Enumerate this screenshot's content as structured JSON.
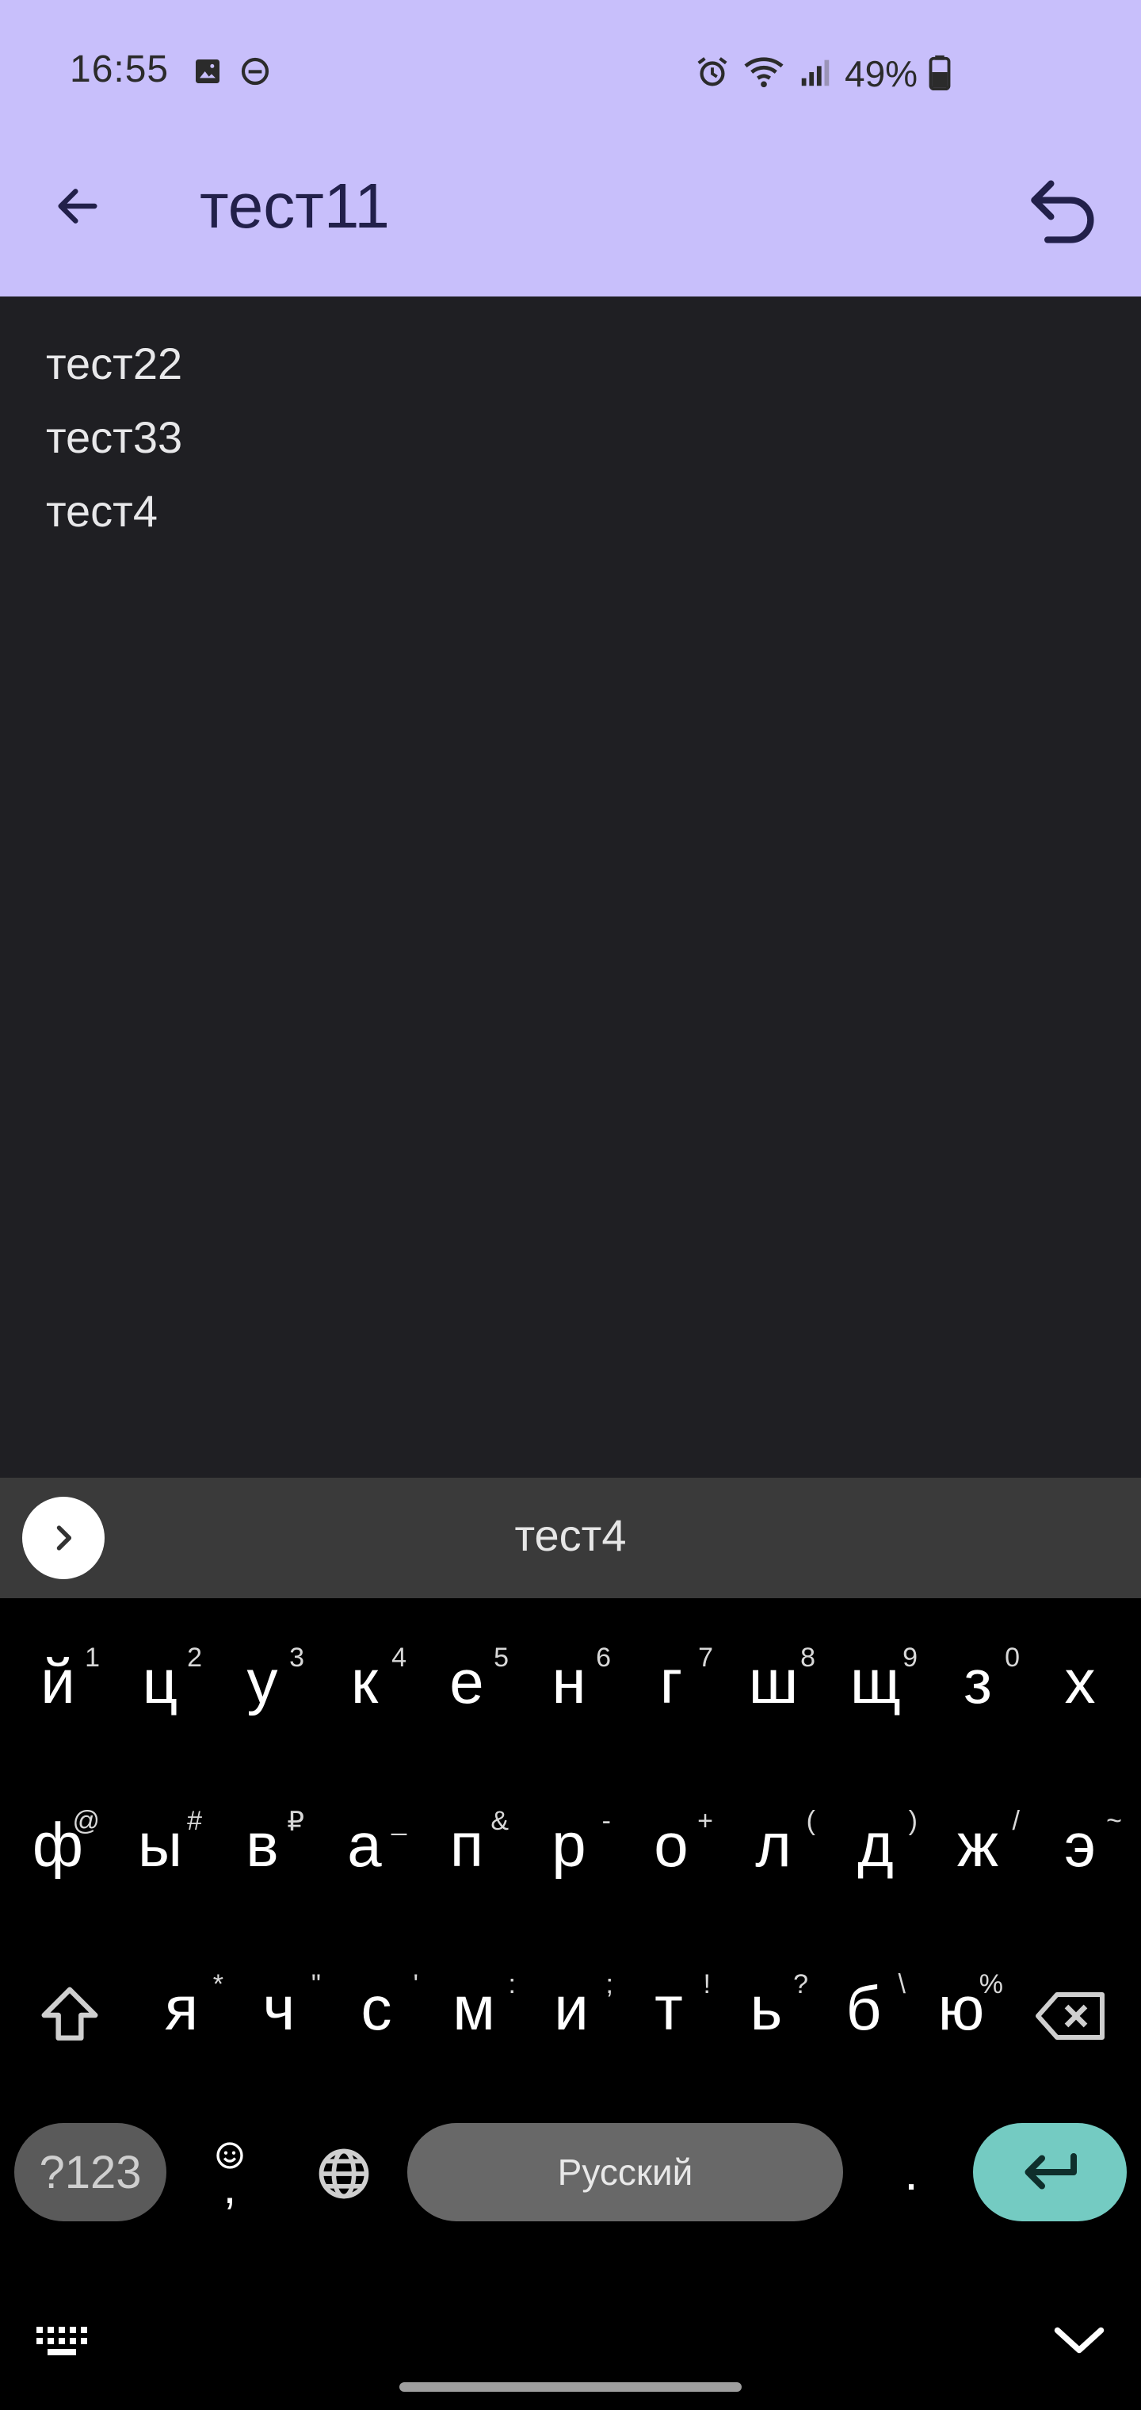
{
  "status": {
    "time": "16:55",
    "battery": "49%"
  },
  "appbar": {
    "title": "тест11"
  },
  "content": {
    "lines": [
      "тест22",
      "тест33",
      "тест4"
    ]
  },
  "suggestion": {
    "word": "тест4"
  },
  "keyboard": {
    "row1": [
      {
        "k": "й",
        "h": "1"
      },
      {
        "k": "ц",
        "h": "2"
      },
      {
        "k": "у",
        "h": "3"
      },
      {
        "k": "к",
        "h": "4"
      },
      {
        "k": "е",
        "h": "5"
      },
      {
        "k": "н",
        "h": "6"
      },
      {
        "k": "г",
        "h": "7"
      },
      {
        "k": "ш",
        "h": "8"
      },
      {
        "k": "щ",
        "h": "9"
      },
      {
        "k": "з",
        "h": "0"
      },
      {
        "k": "х",
        "h": ""
      }
    ],
    "row2": [
      {
        "k": "ф",
        "h": "@"
      },
      {
        "k": "ы",
        "h": "#"
      },
      {
        "k": "в",
        "h": "₽"
      },
      {
        "k": "а",
        "h": "_"
      },
      {
        "k": "п",
        "h": "&"
      },
      {
        "k": "р",
        "h": "-"
      },
      {
        "k": "о",
        "h": "+"
      },
      {
        "k": "л",
        "h": "("
      },
      {
        "k": "д",
        "h": ")"
      },
      {
        "k": "ж",
        "h": "/"
      },
      {
        "k": "э",
        "h": "~"
      }
    ],
    "row3": [
      {
        "k": "я",
        "h": "*"
      },
      {
        "k": "ч",
        "h": "\""
      },
      {
        "k": "с",
        "h": "'"
      },
      {
        "k": "м",
        "h": ":"
      },
      {
        "k": "и",
        "h": ";"
      },
      {
        "k": "т",
        "h": "!"
      },
      {
        "k": "ь",
        "h": "?"
      },
      {
        "k": "б",
        "h": "\\"
      },
      {
        "k": "ю",
        "h": "%"
      }
    ],
    "symbols_label": "?123",
    "comma": ",",
    "space_label": "Русский",
    "period": "."
  }
}
